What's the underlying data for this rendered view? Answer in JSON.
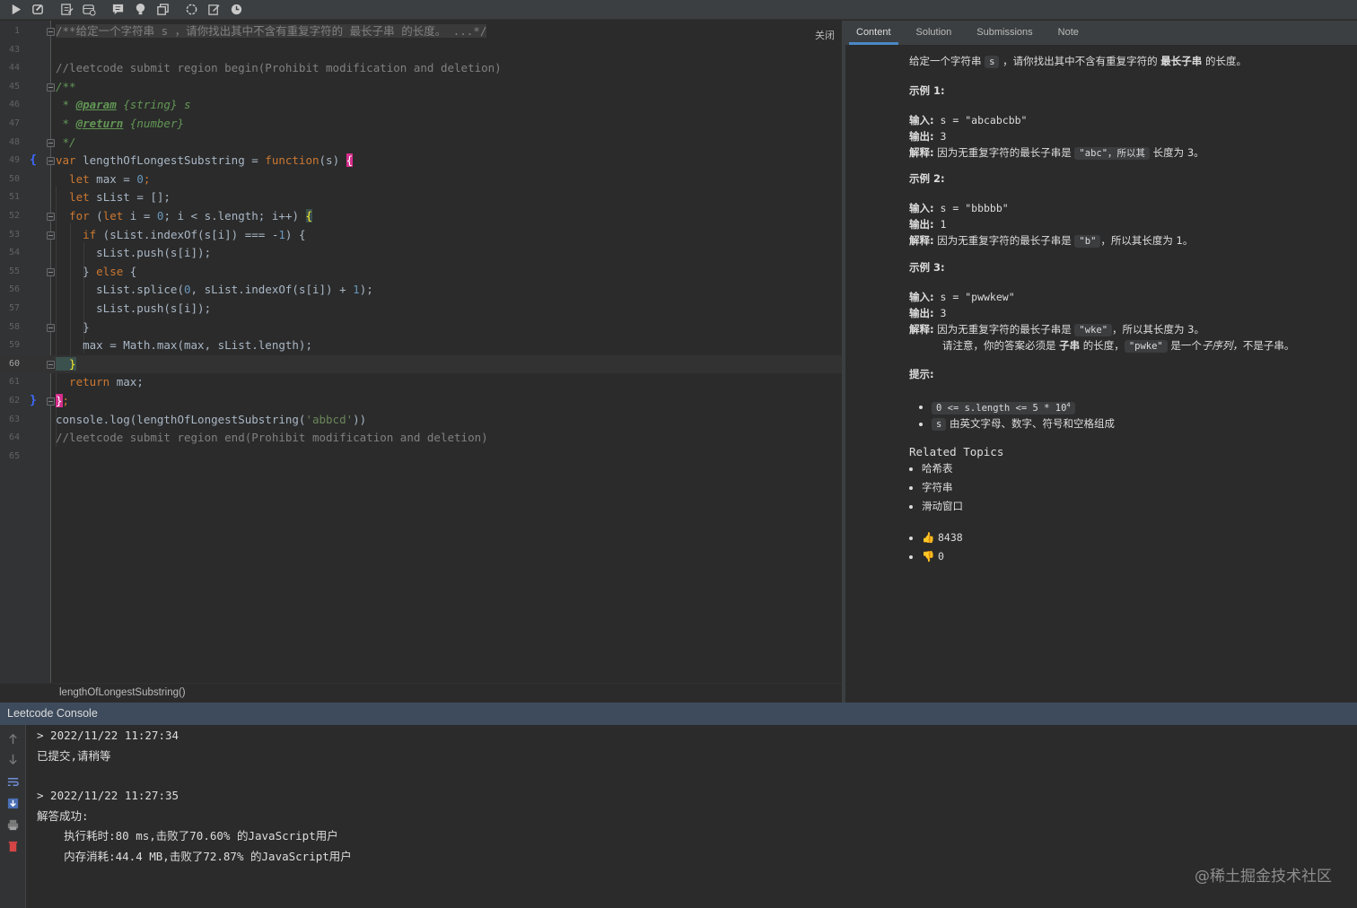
{
  "toolbar": {
    "icons": [
      "run-icon",
      "debug-icon",
      "edit-icon",
      "db-icon",
      "comment-icon",
      "bulb-icon",
      "copy-icon",
      "circle-icon",
      "note-icon",
      "clock-icon"
    ]
  },
  "editor": {
    "close_label": "关闭",
    "line_numbers": [
      "1",
      "43",
      "44",
      "45",
      "46",
      "47",
      "48",
      "49",
      "50",
      "51",
      "52",
      "53",
      "54",
      "55",
      "56",
      "57",
      "58",
      "59",
      "60",
      "61",
      "62",
      "63",
      "64",
      "65"
    ],
    "lines": {
      "l1": "/**给定一个字符串 s ，请你找出其中不含有重复字符的 最长子串 的长度。 ...*/",
      "l44": "//leetcode submit region begin(Prohibit modification and deletion)",
      "l45": "/**",
      "l46_prefix": " * ",
      "l46_tag": "@param",
      "l46_rest": " {string} s",
      "l47_prefix": " * ",
      "l47_tag": "@return",
      "l47_rest": " {number}",
      "l48": " */",
      "l49_kw": "var",
      "l49_name": " lengthOfLongestSubstring = ",
      "l49_fn": "function",
      "l49_args": "(s) ",
      "l49_brace": "{",
      "l50_kw": "  let",
      "l50_mid": " max = ",
      "l50_num": "0",
      "l50_end": ";",
      "l51_kw": "  let",
      "l51_mid": " sList = [];",
      "l52_kw": "  for",
      "l52_a": " (",
      "l52_let": "let",
      "l52_b": " i = ",
      "l52_num": "0",
      "l52_c": "; i < s.length; i++) ",
      "l52_brace": "{",
      "l53_kw": "    if",
      "l53_a": " (sList.indexOf(s[i]) === -",
      "l53_num": "1",
      "l53_b": ") {",
      "l54": "      sList.push(s[i]);",
      "l55_a": "    } ",
      "l55_kw": "else",
      "l55_b": " {",
      "l56_a": "      sList.splice(",
      "l56_num1": "0",
      "l56_b": ", sList.indexOf(s[i]) + ",
      "l56_num2": "1",
      "l56_c": ");",
      "l57": "      sList.push(s[i]);",
      "l58": "    }",
      "l59": "    max = Math.max(max, sList.length);",
      "l60": "  }",
      "l61_kw": "  return",
      "l61_rest": " max;",
      "l62": "}",
      "l62_end": ";",
      "l63_a": "console.log(lengthOfLongestSubstring(",
      "l63_str": "'abbcd'",
      "l63_b": "))",
      "l64": "//leetcode submit region end(Prohibit modification and deletion)"
    },
    "breadcrumb": "lengthOfLongestSubstring()"
  },
  "problem": {
    "tabs": [
      "Content",
      "Solution",
      "Submissions",
      "Note"
    ],
    "active_tab": "Content",
    "intro_a": "给定一个字符串",
    "intro_chip": "s",
    "intro_b": "，请你找出其中不含有重复字符的",
    "intro_bold": "最长子串",
    "intro_c": "的长度。",
    "examples": [
      {
        "title": "示例 1:",
        "input_label": "输入:",
        "input": " s = \"abcabcbb\"",
        "output_label": "输出:",
        "output": " 3",
        "explain_label": "解释:",
        "explain_a": " 因为无重复字符的最长子串是 ",
        "explain_chip": "\"abc\"，所以其",
        "explain_b": " 长度为 3。"
      },
      {
        "title": "示例 2:",
        "input_label": "输入:",
        "input": " s = \"bbbbb\"",
        "output_label": "输出:",
        "output": " 1",
        "explain_label": "解释:",
        "explain_a": " 因为无重复字符的最长子串是 ",
        "explain_chip": "\"b\"",
        "explain_b": "，所以其长度为 1。"
      },
      {
        "title": "示例 3:",
        "input_label": "输入:",
        "input": " s = \"pwwkew\"",
        "output_label": "输出:",
        "output": " 3",
        "explain_label": "解释:",
        "explain_a": " 因为无重复字符的最长子串是 ",
        "explain_chip": "\"wke\"",
        "explain_b": "，所以其长度为 3。",
        "note_a": "请注意，你的答案必须是 ",
        "note_bold": "子串",
        "note_b": " 的长度，",
        "note_chip": "\"pwke\"",
        "note_c": " 是一个",
        "note_italic": "子序列，",
        "note_d": "不是子串。"
      }
    ],
    "hints_title": "提示:",
    "hint1_chip": "0 <= s.length <= 5 * 10",
    "hint1_sup": "4",
    "hint2_chip": "s",
    "hint2_text": " 由英文字母、数字、符号和空格组成",
    "related_title": "Related Topics",
    "topics": [
      "哈希表",
      "字符串",
      "滑动窗口"
    ],
    "likes": "8438",
    "dislikes": "0",
    "like_icon": "👍",
    "dislike_icon": "👎"
  },
  "console": {
    "title": "Leetcode Console",
    "lines": [
      "> 2022/11/22 11:27:34",
      "已提交,请稍等",
      "> 2022/11/22 11:27:35",
      "解答成功:",
      "    执行耗时:80 ms,击败了70.60% 的JavaScript用户",
      "    内存消耗:44.4 MB,击败了72.87% 的JavaScript用户"
    ]
  },
  "watermark": "@稀土掘金技术社区",
  "colors": {
    "keyword": "#cc7832",
    "number": "#6897bb",
    "string": "#6a8759",
    "comment": "#808080",
    "doc": "#629755",
    "function": "#ffc66d",
    "tab_active": "#4a88c7",
    "console_header": "#3d4b5c"
  }
}
